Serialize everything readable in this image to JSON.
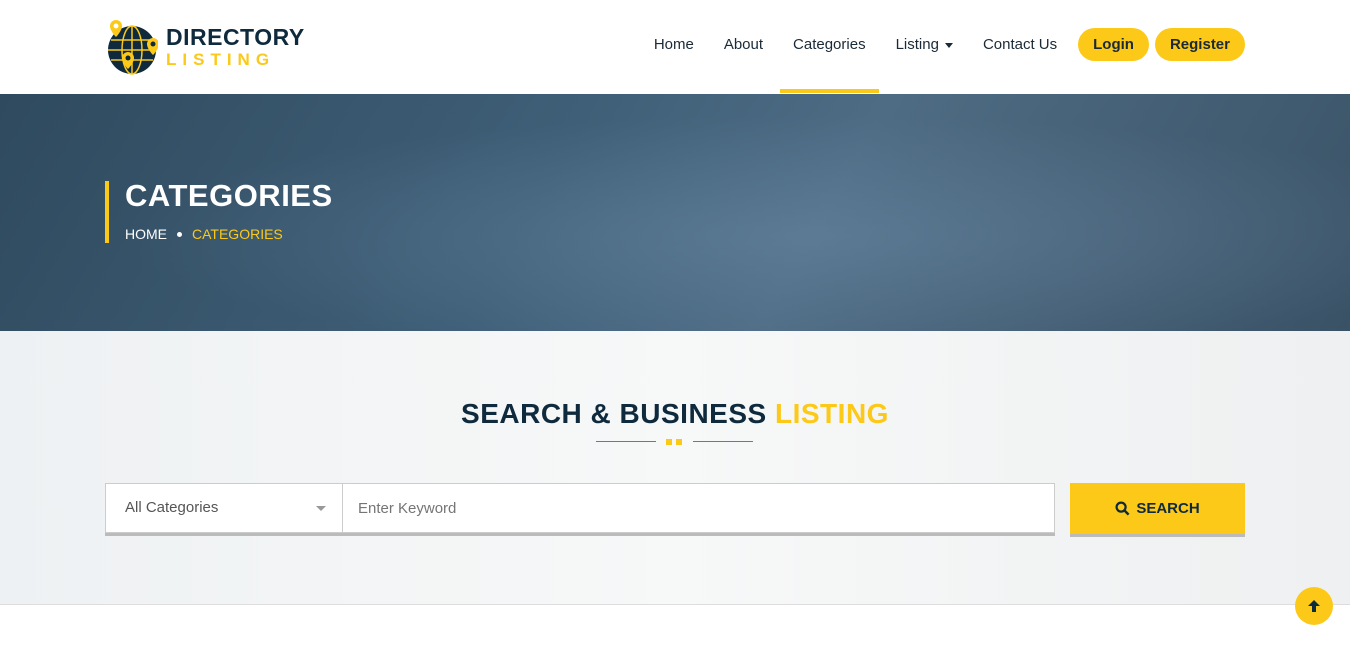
{
  "logo": {
    "line1": "DIRECTORY",
    "line2": "LISTING"
  },
  "nav": {
    "items": [
      {
        "label": "Home"
      },
      {
        "label": "About"
      },
      {
        "label": "Categories"
      },
      {
        "label": "Listing"
      },
      {
        "label": "Contact Us"
      }
    ],
    "login": "Login",
    "register": "Register"
  },
  "hero": {
    "title": "CATEGORIES",
    "breadcrumb": {
      "home": "HOME",
      "current": "CATEGORIES"
    }
  },
  "search": {
    "title_main": "SEARCH & BUSINESS",
    "title_accent": "LISTING",
    "category_selected": "All Categories",
    "keyword_placeholder": "Enter Keyword",
    "button": "SEARCH"
  },
  "colors": {
    "accent": "#fcc918",
    "dark": "#0f2a3d"
  }
}
